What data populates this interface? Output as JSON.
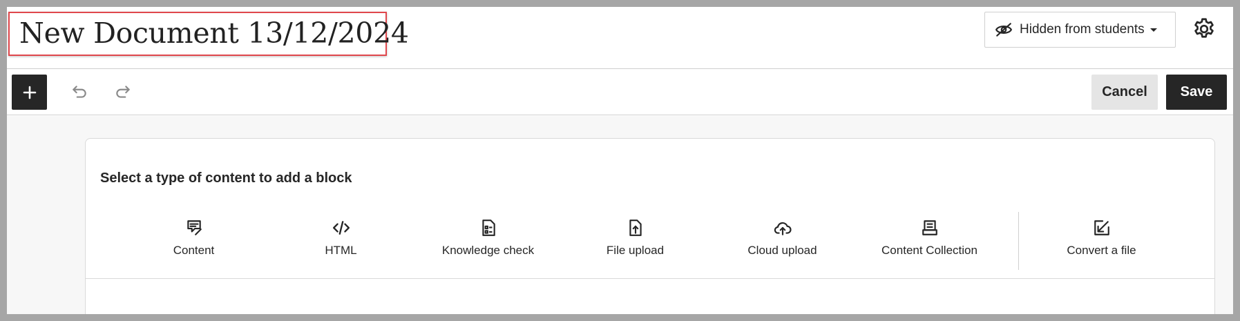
{
  "header": {
    "title": "New Document 13/12/2024",
    "visibility_label": "Hidden from students",
    "visibility_icon": "eye-slash-icon",
    "settings_icon": "gear-icon"
  },
  "toolbar": {
    "add_icon": "plus-icon",
    "undo_icon": "undo-icon",
    "redo_icon": "redo-icon",
    "cancel_label": "Cancel",
    "save_label": "Save"
  },
  "content": {
    "prompt": "Select a type of content to add a block",
    "types": [
      {
        "label": "Content",
        "icon": "content-edit-icon"
      },
      {
        "label": "HTML",
        "icon": "code-icon"
      },
      {
        "label": "Knowledge check",
        "icon": "knowledge-check-icon"
      },
      {
        "label": "File upload",
        "icon": "file-upload-icon"
      },
      {
        "label": "Cloud upload",
        "icon": "cloud-upload-icon"
      },
      {
        "label": "Content Collection",
        "icon": "content-collection-icon"
      },
      {
        "label": "Convert a file",
        "icon": "convert-file-icon"
      }
    ]
  },
  "colors": {
    "accent_dark": "#262626",
    "title_outline": "#e0474c",
    "canvas_bg": "#f7f7f7",
    "cancel_bg": "#e5e5e5"
  }
}
